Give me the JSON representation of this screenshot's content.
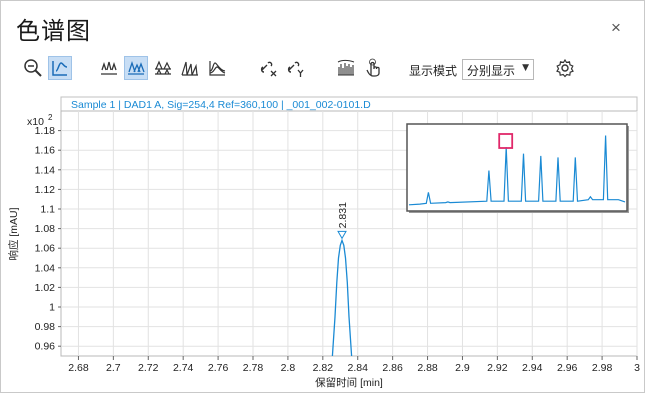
{
  "window": {
    "title": "色谱图",
    "close_label": "×"
  },
  "toolbar": {
    "icons": [
      "zoom-reset-icon",
      "peak-select-icon",
      "stacked-peaks-icon",
      "overlay-peaks-icon",
      "separate-peaks-icon",
      "tilted-peaks-icon",
      "skewed-peaks-icon",
      "link-x-icon",
      "link-y-icon",
      "spectrum-icon",
      "hand-pointer-icon",
      "settings-gear-icon"
    ],
    "display_mode_label": "显示模式",
    "display_mode_value": "分别显示",
    "accent": "#1a8ad4",
    "active_bg": "#c8def5"
  },
  "chart_data": {
    "type": "line",
    "header": "Sample 1 | DAD1 A, Sig=254,4 Ref=360,100 | _001_002-0101.D",
    "xlabel": "保留时间 [min]",
    "ylabel": "响应 [mAU]",
    "y_multiplier": "x10",
    "y_multiplier_exp": "2",
    "xlim": [
      2.67,
      3.0
    ],
    "ylim": [
      0.95,
      1.2
    ],
    "x_ticks": [
      "2.68",
      "2.7",
      "2.72",
      "2.74",
      "2.76",
      "2.78",
      "2.8",
      "2.82",
      "2.84",
      "2.86",
      "2.88",
      "2.9",
      "2.92",
      "2.94",
      "2.96",
      "2.98",
      "3"
    ],
    "y_ticks": [
      "0.96",
      "0.98",
      "1",
      "1.02",
      "1.04",
      "1.06",
      "1.08",
      "1.1",
      "1.12",
      "1.14",
      "1.16",
      "1.18"
    ],
    "grid": true,
    "peak": {
      "apex_x": 2.831,
      "apex_y": 1.068,
      "label": "2.831"
    },
    "series": [
      {
        "x": [
          2.8255,
          2.827,
          2.828,
          2.829,
          2.83,
          2.831,
          2.832,
          2.833,
          2.834,
          2.835,
          2.8365
        ],
        "y": [
          0.95,
          0.99,
          1.025,
          1.05,
          1.063,
          1.068,
          1.063,
          1.05,
          1.025,
          0.99,
          0.95
        ]
      }
    ],
    "line_color": "#1a8ad4",
    "inset": {
      "x": [
        0.0,
        0.05,
        0.08,
        0.09,
        0.1,
        0.17,
        0.18,
        0.19,
        0.36,
        0.37,
        0.38,
        0.44,
        0.45,
        0.46,
        0.52,
        0.53,
        0.54,
        0.6,
        0.61,
        0.62,
        0.68,
        0.69,
        0.7,
        0.76,
        0.77,
        0.78,
        0.83,
        0.84,
        0.85,
        0.9,
        0.91,
        0.92,
        0.97,
        1.0
      ],
      "y": [
        0.03,
        0.04,
        0.05,
        0.2,
        0.05,
        0.06,
        0.07,
        0.06,
        0.08,
        0.5,
        0.08,
        0.08,
        0.82,
        0.08,
        0.08,
        0.73,
        0.08,
        0.08,
        0.7,
        0.08,
        0.08,
        0.68,
        0.08,
        0.08,
        0.68,
        0.08,
        0.1,
        0.14,
        0.1,
        0.1,
        0.98,
        0.1,
        0.1,
        0.07
      ],
      "marker_x": 0.45,
      "marker_color": "#e0286a"
    }
  }
}
